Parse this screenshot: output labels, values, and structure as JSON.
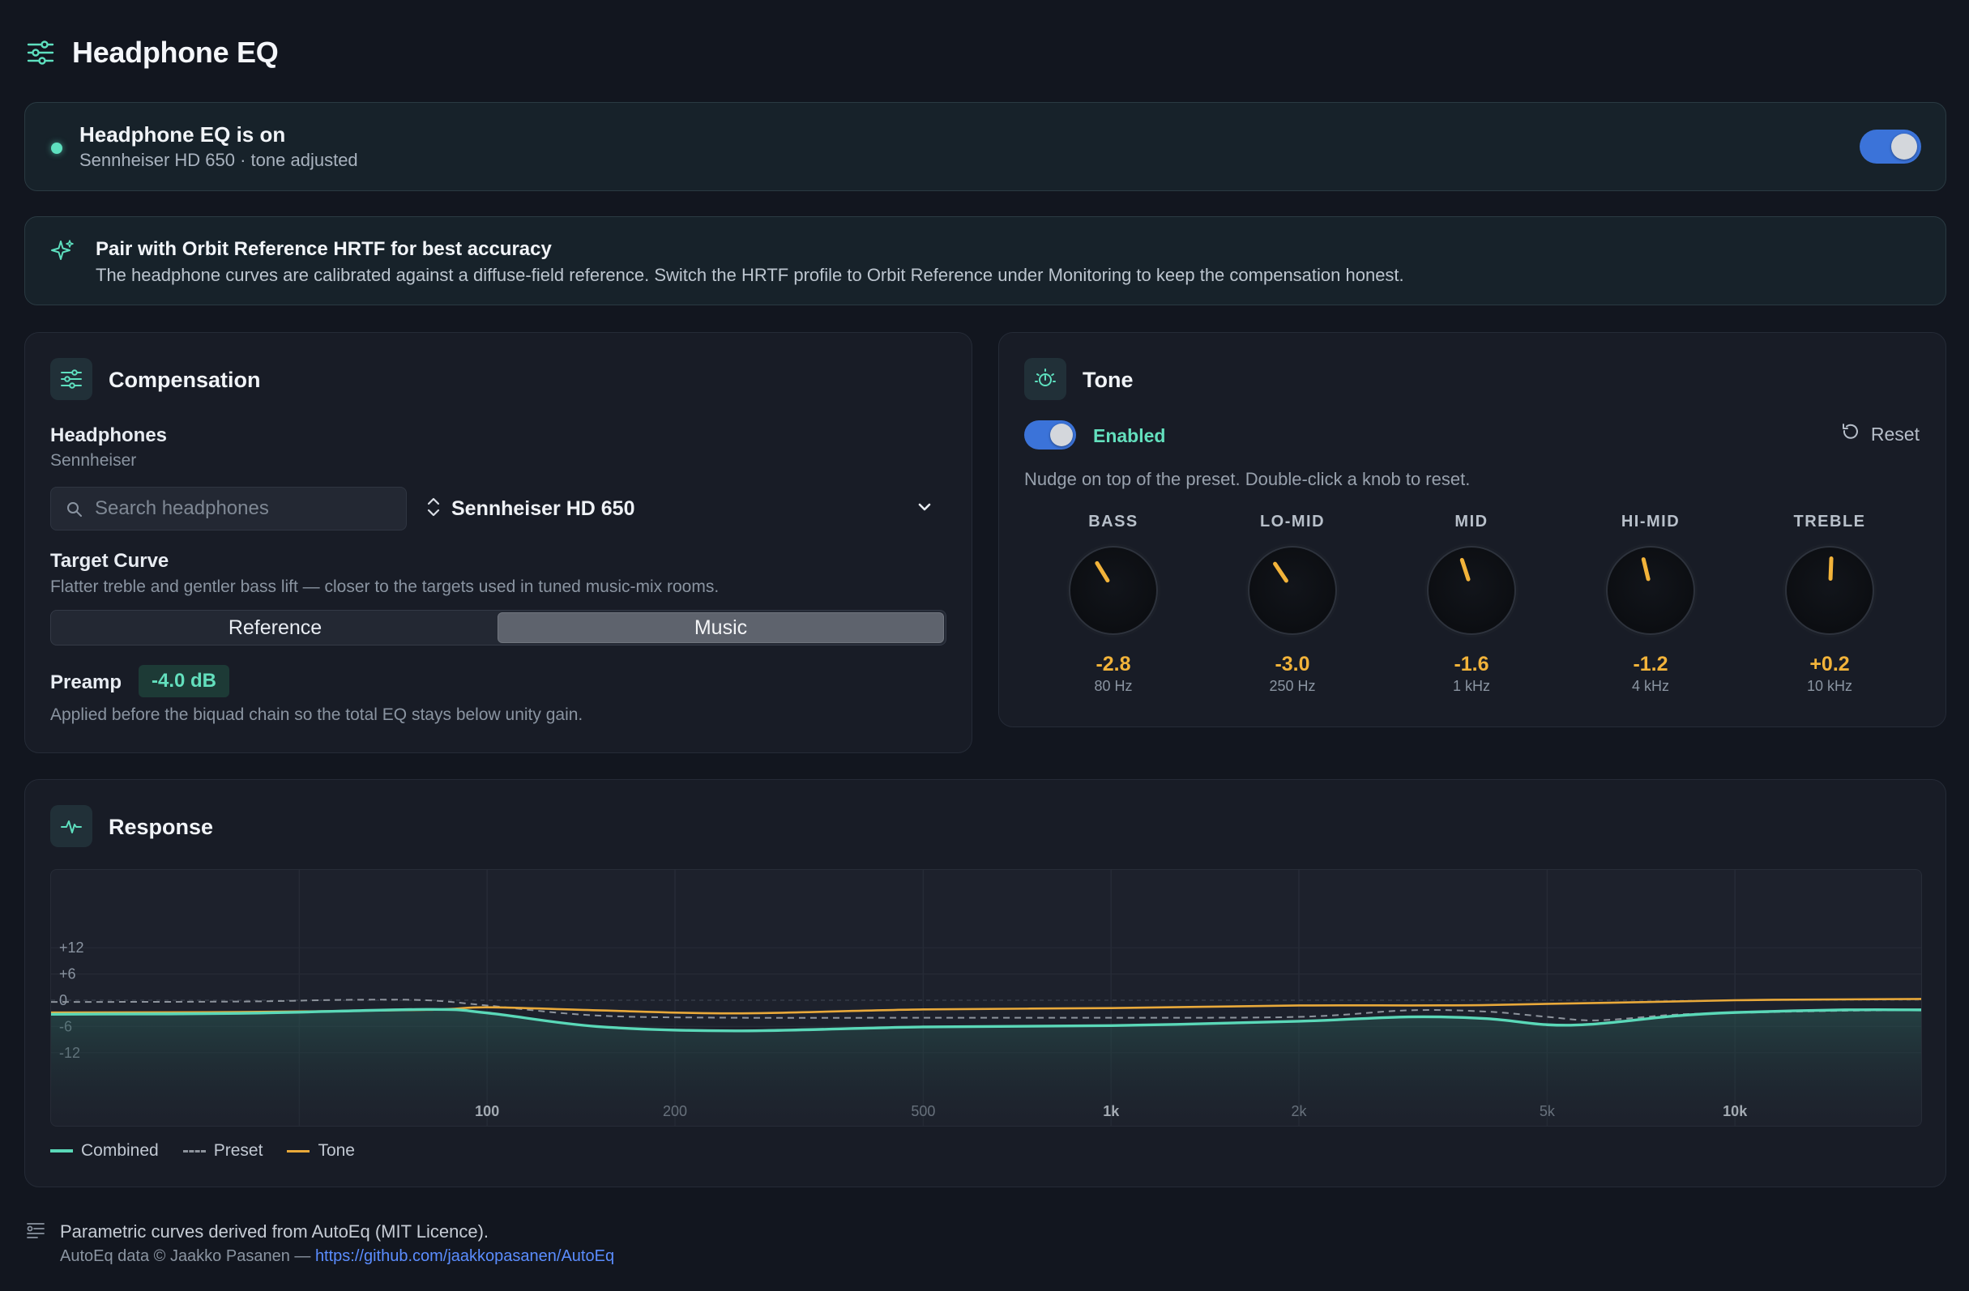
{
  "app": {
    "title": "Headphone EQ",
    "menu_icon": "sliders-icon"
  },
  "status": {
    "title": "Headphone EQ is on",
    "subtitle": "Sennheiser HD 650 · tone adjusted",
    "enabled": true
  },
  "tip": {
    "icon": "sparkle-icon",
    "title": "Pair with Orbit Reference HRTF for best accuracy",
    "body": "The headphone curves are calibrated against a diffuse-field reference. Switch the HRTF profile to Orbit Reference under Monitoring to keep the compensation honest."
  },
  "compensation": {
    "title": "Compensation",
    "headphones_label": "Headphones",
    "brand": "Sennheiser",
    "search_placeholder": "Search headphones",
    "selected_model": "Sennheiser HD 650",
    "target_label": "Target Curve",
    "target_desc": "Flatter treble and gentler bass lift — closer to the targets used in tuned music-mix rooms.",
    "target_options": [
      "Reference",
      "Music"
    ],
    "target_selected": "Music",
    "preamp_label": "Preamp",
    "preamp_value": "-4.0 dB",
    "preamp_desc": "Applied before the biquad chain so the total EQ stays below unity gain."
  },
  "tone": {
    "title": "Tone",
    "enabled_label": "Enabled",
    "enabled": true,
    "reset_label": "Reset",
    "note": "Nudge on top of the preset. Double-click a knob to reset.",
    "bands": [
      {
        "name": "BASS",
        "value": "-2.8",
        "freq": "80 Hz",
        "gain": -2.8
      },
      {
        "name": "LO-MID",
        "value": "-3.0",
        "freq": "250 Hz",
        "gain": -3.0
      },
      {
        "name": "MID",
        "value": "-1.6",
        "freq": "1 kHz",
        "gain": -1.6
      },
      {
        "name": "HI-MID",
        "value": "-1.2",
        "freq": "4 kHz",
        "gain": -1.2
      },
      {
        "name": "TREBLE",
        "value": "+0.2",
        "freq": "10 kHz",
        "gain": 0.2
      }
    ]
  },
  "response": {
    "title": "Response",
    "legend": [
      "Combined",
      "Preset",
      "Tone"
    ],
    "colors": {
      "combined": "#5ad8b8",
      "preset": "#8d939c",
      "tone": "#e9a93a"
    }
  },
  "chart_data": {
    "type": "line",
    "x_scale": "log",
    "xlim": [
      20,
      20000
    ],
    "ylim": [
      -16,
      16
    ],
    "y_ticks": [
      "+12",
      "+6",
      "0",
      "-6",
      "-12"
    ],
    "y_tick_values": [
      12,
      6,
      0,
      -6,
      -12
    ],
    "x_ticks": [
      "100",
      "200",
      "500",
      "1k",
      "2k",
      "5k",
      "10k"
    ],
    "x_tick_values": [
      100,
      200,
      500,
      1000,
      2000,
      5000,
      10000
    ],
    "series": [
      {
        "name": "Combined",
        "x": [
          20,
          40,
          80,
          100,
          150,
          250,
          500,
          1000,
          2000,
          3000,
          4000,
          5000,
          6000,
          8000,
          10000,
          15000,
          20000
        ],
        "y": [
          -3.2,
          -3.0,
          -2.1,
          -2.9,
          -6.0,
          -7.0,
          -6.1,
          -5.8,
          -4.8,
          -3.8,
          -4.2,
          -5.6,
          -5.4,
          -3.6,
          -2.8,
          -2.2,
          -2.2
        ]
      },
      {
        "name": "Preset",
        "x": [
          20,
          40,
          60,
          80,
          100,
          150,
          250,
          500,
          1000,
          2000,
          3000,
          4000,
          5000,
          6000,
          8000,
          10000,
          15000,
          20000
        ],
        "y": [
          -0.4,
          -0.3,
          0.1,
          0.0,
          -1.2,
          -3.5,
          -4.0,
          -4.0,
          -4.0,
          -3.8,
          -2.3,
          -2.6,
          -3.8,
          -4.6,
          -3.3,
          -2.9,
          -2.4,
          -2.3
        ]
      },
      {
        "name": "Tone",
        "x": [
          20,
          40,
          80,
          100,
          150,
          250,
          500,
          1000,
          2000,
          4000,
          10000,
          20000
        ],
        "y": [
          -2.8,
          -2.7,
          -2.2,
          -1.6,
          -2.3,
          -3.0,
          -2.1,
          -1.8,
          -1.2,
          -1.1,
          0.0,
          0.3
        ]
      }
    ]
  },
  "footer": {
    "icon": "license-icon",
    "main": "Parametric curves derived from AutoEq (MIT Licence).",
    "sub_prefix": "AutoEq data © Jaakko Pasanen — ",
    "link": "https://github.com/jaakkopasanen/AutoEq"
  }
}
